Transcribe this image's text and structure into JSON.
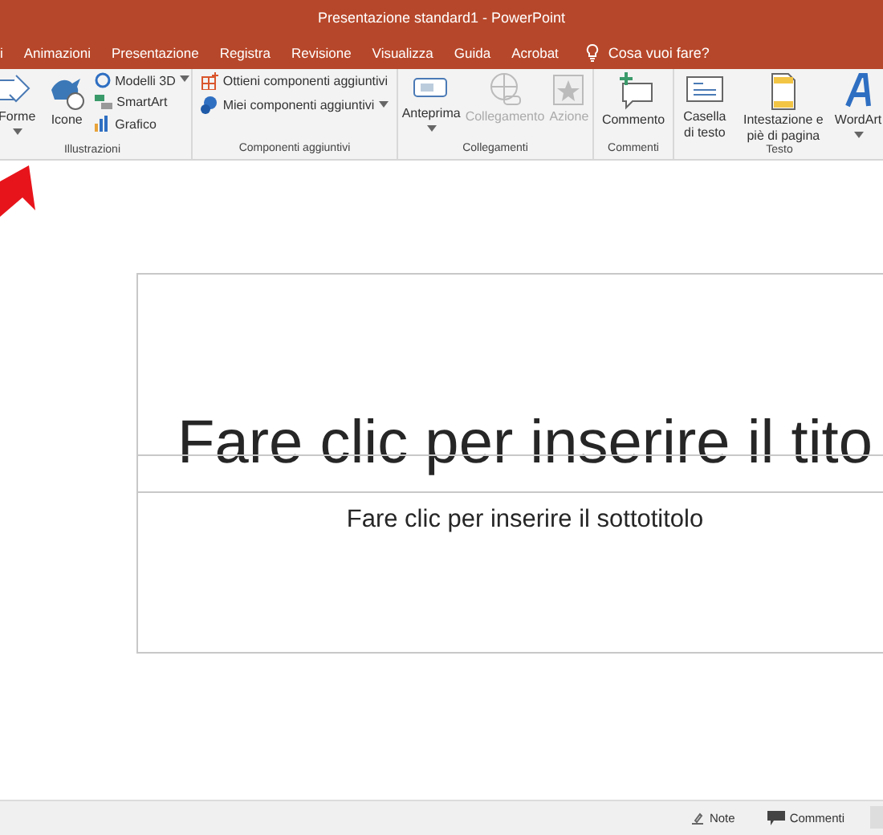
{
  "window": {
    "title": "Presentazione standard1  -  PowerPoint"
  },
  "tabs": [
    {
      "label": "i"
    },
    {
      "label": "Animazioni"
    },
    {
      "label": "Presentazione"
    },
    {
      "label": "Registra"
    },
    {
      "label": "Revisione"
    },
    {
      "label": "Visualizza"
    },
    {
      "label": "Guida"
    },
    {
      "label": "Acrobat"
    }
  ],
  "tell_me": {
    "placeholder": "Cosa vuoi fare?"
  },
  "ribbon_groups": [
    {
      "label": "Illustrazioni",
      "items": [
        {
          "kind": "large",
          "label": "Forme",
          "caret": true,
          "disabled": false
        },
        {
          "kind": "large",
          "label": "Icone",
          "caret": false,
          "disabled": false
        },
        {
          "kind": "small",
          "label": "Modelli 3D",
          "caret": true,
          "disabled": false
        },
        {
          "kind": "small",
          "label": "SmartArt",
          "caret": false,
          "disabled": false
        },
        {
          "kind": "small",
          "label": "Grafico",
          "caret": false,
          "disabled": false
        }
      ]
    },
    {
      "label": "Componenti aggiuntivi",
      "items": [
        {
          "kind": "small",
          "label": "Ottieni componenti aggiuntivi",
          "caret": false,
          "disabled": false
        },
        {
          "kind": "small",
          "label": "Miei componenti aggiuntivi",
          "caret": true,
          "disabled": false
        }
      ]
    },
    {
      "label": "Collegamenti",
      "items": [
        {
          "kind": "large",
          "label": "Anteprima",
          "caret": true,
          "disabled": false
        },
        {
          "kind": "large",
          "label": "Collegamento",
          "caret": false,
          "disabled": true
        },
        {
          "kind": "large",
          "label": "Azione",
          "caret": false,
          "disabled": true
        }
      ]
    },
    {
      "label": "Commenti",
      "items": [
        {
          "kind": "large",
          "label": "Commento",
          "caret": false,
          "disabled": false
        }
      ]
    },
    {
      "label": "Testo",
      "items": [
        {
          "kind": "large",
          "label": "Casella di testo",
          "caret": false,
          "disabled": false
        },
        {
          "kind": "large",
          "label": "Intestazione e piè di pagina",
          "caret": false,
          "disabled": false
        },
        {
          "kind": "large",
          "label": "WordArt",
          "caret": true,
          "disabled": false
        }
      ]
    }
  ],
  "slide": {
    "title_placeholder": "Fare clic per inserire il tito",
    "subtitle_placeholder": "Fare clic per inserire il sottotitolo"
  },
  "status_bar": {
    "items": [
      "Note",
      "Commenti"
    ]
  }
}
